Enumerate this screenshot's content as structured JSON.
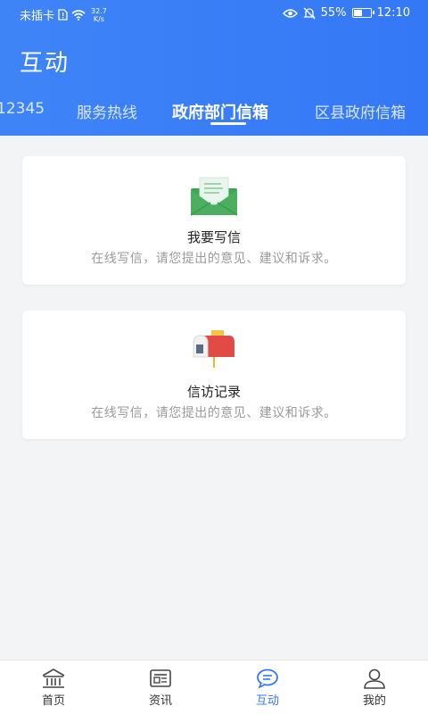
{
  "status_bar": {
    "carrier": "未插卡",
    "speed_value": "32.7",
    "speed_unit": "K/s",
    "battery": "55%",
    "battery_level": 0.55,
    "time": "12:10"
  },
  "header": {
    "title": "互动",
    "tabs": [
      {
        "label": "12345"
      },
      {
        "label": "服务热线"
      },
      {
        "label": "政府部门信箱",
        "active": true
      },
      {
        "label": "区县政府信箱"
      }
    ]
  },
  "cards": [
    {
      "icon": "mail-envelope-icon",
      "title": "我要写信",
      "subtitle": "在线写信，请您提出的意见、建议和诉求。"
    },
    {
      "icon": "mailbox-icon",
      "title": "信访记录",
      "subtitle": "在线写信，请您提出的意见、建议和诉求。"
    }
  ],
  "bottom_nav": [
    {
      "label": "首页",
      "icon": "home-icon"
    },
    {
      "label": "资讯",
      "icon": "news-icon"
    },
    {
      "label": "互动",
      "icon": "chat-icon",
      "active": true
    },
    {
      "label": "我的",
      "icon": "user-icon"
    }
  ],
  "colors": {
    "primary": "#3478f6",
    "background": "#f3f4f6",
    "envelope_green": "#3fa755",
    "mailbox_red": "#e24b45"
  }
}
